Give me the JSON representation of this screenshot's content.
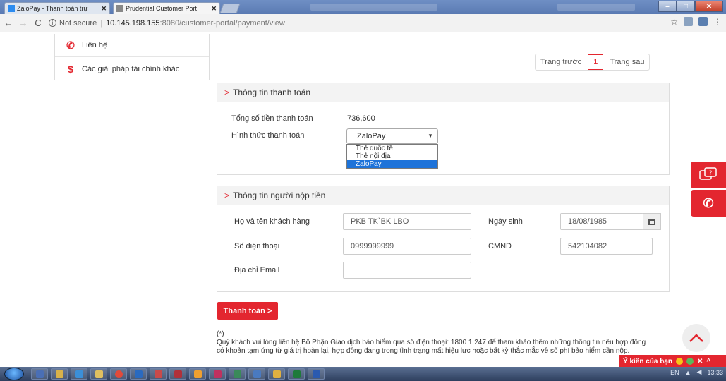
{
  "browser": {
    "tabs": [
      {
        "label": "ZaloPay - Thanh toán trự",
        "active": false
      },
      {
        "label": "Prudential Customer Port",
        "active": true
      }
    ],
    "nav": {
      "not_secure": "Not secure",
      "host": "10.145.198.155",
      "path": ":8080/customer-portal/payment/view"
    }
  },
  "sidebar": {
    "items": [
      {
        "label": "Liên hệ",
        "icon": "phone-icon"
      },
      {
        "label": "Các giải pháp tài chính khác",
        "icon": "dollar-icon"
      }
    ]
  },
  "pager": {
    "prev": "Trang trước",
    "current": "1",
    "next": "Trang sau"
  },
  "payment_info": {
    "title": "Thông tin thanh toán",
    "total_label": "Tổng số tiền thanh toán",
    "total_value": "736,600",
    "method_label": "Hình thức thanh toán",
    "method_selected": "ZaloPay",
    "method_options": [
      "Thẻ quốc tế",
      "Thẻ nội địa",
      "ZaloPay"
    ]
  },
  "payer_info": {
    "title": "Thông tin người nộp tiền",
    "name_label": "Họ và tên khách hàng",
    "name_value": "PKB TK`BK LBO",
    "dob_label": "Ngày sinh",
    "dob_value": "18/08/1985",
    "phone_label": "Số điện thoại",
    "phone_value": "0999999999",
    "id_label": "CMND",
    "id_value": "542104082",
    "email_label": "Địa chỉ Email",
    "email_value": ""
  },
  "actions": {
    "pay_label": "Thanh toán >"
  },
  "note": {
    "marker": "(*)",
    "text": "Quý khách vui lòng liên hệ Bộ Phận Giao dịch bảo hiểm qua số điện thoại: 1800 1 247 để tham khảo thêm những thông tin nếu hợp đồng có khoản tạm ứng từ giá trị hoàn lại, hợp đồng đang trong tình trạng mất hiệu lực hoặc bất kỳ thắc mắc về số phí bảo hiểm cần nộp."
  },
  "feedback": {
    "label": "Ý kiến của bạn"
  },
  "taskbar": {
    "lang": "EN",
    "time": "13:33"
  },
  "colors": {
    "accent": "#e3262f",
    "select_highlight": "#1e73d9"
  }
}
